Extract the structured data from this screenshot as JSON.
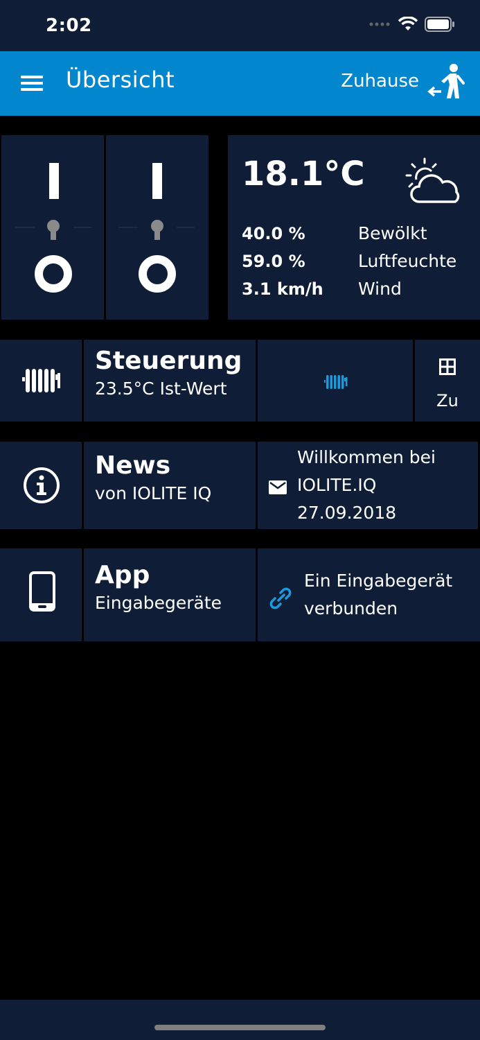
{
  "status_bar": {
    "time": "2:02"
  },
  "app_bar": {
    "title": "Übersicht",
    "mode_label": "Zuhause"
  },
  "weather": {
    "temperature": "18.1°C",
    "stats": [
      {
        "value": "40.0 %",
        "label": "Bewölkt"
      },
      {
        "value": "59.0 %",
        "label": "Luftfeuchte"
      },
      {
        "value": "3.1 km/h",
        "label": "Wind"
      }
    ]
  },
  "switches": [
    {
      "on_symbol": "I",
      "off_symbol": "O"
    },
    {
      "on_symbol": "I",
      "off_symbol": "O"
    }
  ],
  "heating": {
    "title": "Steuerung",
    "subtitle": "23.5°C Ist-Wert",
    "window_label": "Zu"
  },
  "news": {
    "title": "News",
    "subtitle": "von IOLITE IQ",
    "message_line1": "Willkommen bei",
    "message_line2": "IOLITE.IQ",
    "message_date": "27.09.2018"
  },
  "app": {
    "title": "App",
    "subtitle": "Eingabegeräte",
    "status_line1": "Ein Eingabegerät",
    "status_line2": "verbunden"
  },
  "colors": {
    "app_bar": "#0287cf",
    "tile": "#0f1d36",
    "accent_icon": "#1a9be0",
    "background": "#000000"
  }
}
